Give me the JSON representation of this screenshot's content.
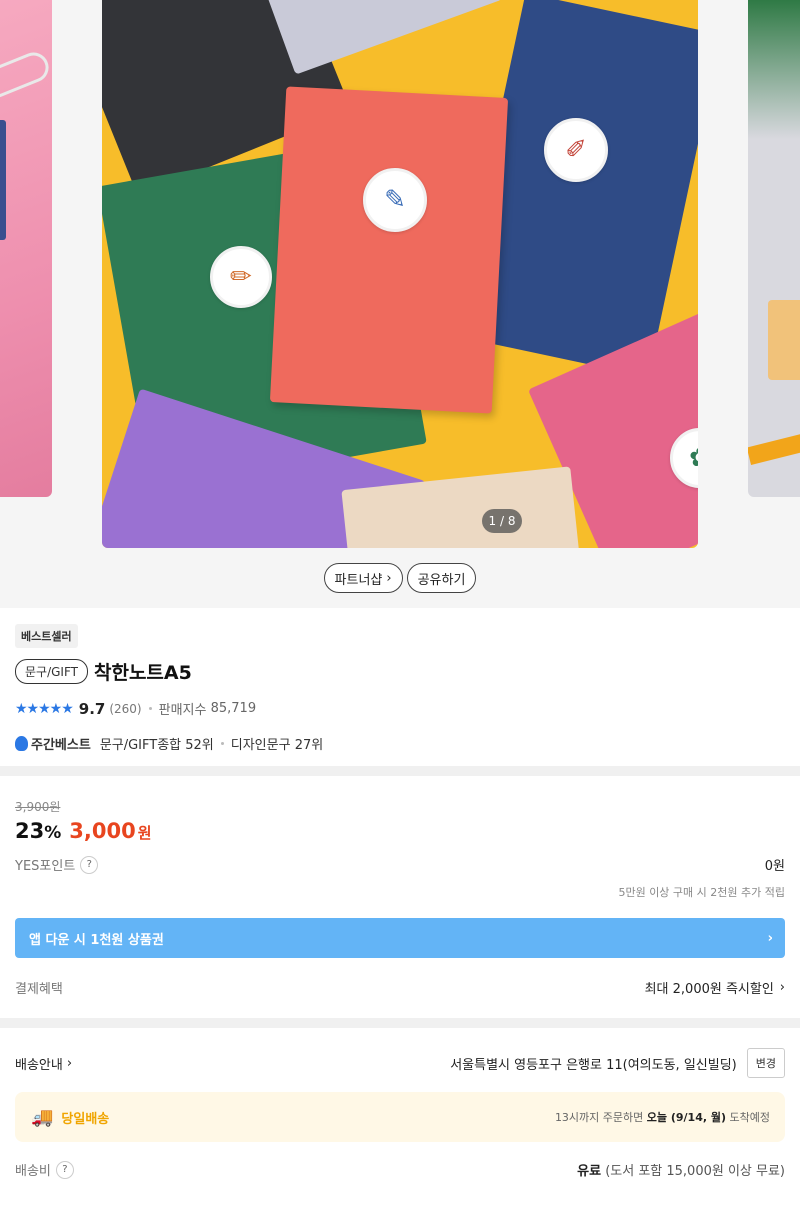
{
  "gallery": {
    "counter": "1 / 8",
    "partner_label": "파트너샵",
    "share_label": "공유하기"
  },
  "product": {
    "badge": "베스트셀러",
    "category": "문구/GIFT",
    "title": "착한노트A5",
    "stars": "★★★★★",
    "rating": "9.7",
    "review_count": "(260)",
    "sales_index_label": "판매지수",
    "sales_index": "85,719",
    "weekly_best_label": "주간베스트",
    "rank1": "문구/GIFT종합 52위",
    "rank2": "디자인문구 27위"
  },
  "price": {
    "original": "3,900원",
    "discount": "23",
    "discount_unit": "%",
    "sale": "3,000",
    "sale_unit": "원",
    "points_label": "YES포인트",
    "points_value": "0원",
    "points_note": "5만원 이상 구매 시 2천원 추가 적립",
    "coupon_banner": "앱 다운 시 1천원 상품권",
    "payment_label": "결제혜택",
    "payment_value": "최대 2,000원 즉시할인"
  },
  "shipping": {
    "label": "배송안내",
    "address": "서울특별시 영등포구 은행로 11(여의도동, 일신빌딩)",
    "change_label": "변경",
    "sameday_label": "당일배송",
    "sameday_prefix": "13시까지 주문하면 ",
    "sameday_date": "오늘 (9/14, 월)",
    "sameday_suffix": " 도착예정",
    "fee_label": "배송비",
    "fee_value_bold": "유료",
    "fee_value_rest": " (도서 포함 15,000원 이상 무료)"
  },
  "colors": {
    "accent_blue": "#2b78e4",
    "sale_red": "#e8451f",
    "coupon_blue": "#63b4f6",
    "sameday_yellow": "#f0a500"
  }
}
